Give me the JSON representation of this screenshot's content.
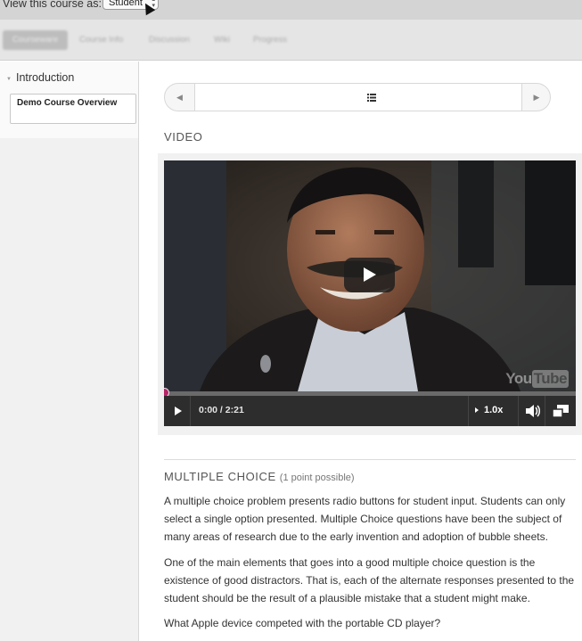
{
  "view_bar": {
    "label": "View this course as:",
    "role_value": "Student"
  },
  "tabs": [
    "Courseware",
    "Course Info",
    "Discussion",
    "Wiki",
    "Progress"
  ],
  "sidebar": {
    "chapter_title": "Introduction",
    "section_label": "Demo Course Overview"
  },
  "sequence_nav": {
    "prev_icon": "chevron-left-icon",
    "middle_icon": "list-icon",
    "next_icon": "chevron-right-icon"
  },
  "video": {
    "heading": "VIDEO",
    "time": "0:00 / 2:21",
    "speed": "1.0x",
    "watermark": "YouTube",
    "progress": 0,
    "accent_color": "#b62568"
  },
  "problem": {
    "heading": "MULTIPLE CHOICE",
    "points": "(1 point possible)",
    "para1": "A multiple choice problem presents radio buttons for student input. Students can only select a single option presented. Multiple Choice questions have been the subject of many areas of research due to the early invention and adoption of bubble sheets.",
    "para2": "One of the main elements that goes into a good multiple choice question is the existence of good distractors. That is, each of the alternate responses presented to the student should be the result of a plausible mistake that a student might make.",
    "question": "What Apple device competed with the portable CD player?"
  }
}
